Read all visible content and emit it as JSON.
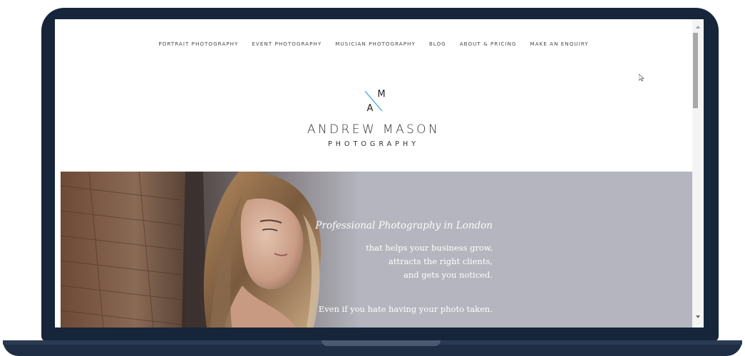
{
  "nav": {
    "items": [
      {
        "label": "PORTRAIT PHOTOGRAPHY"
      },
      {
        "label": "EVENT PHOTOGRAPHY"
      },
      {
        "label": "MUSICIAN PHOTOGRAPHY"
      },
      {
        "label": "BLOG"
      },
      {
        "label": "ABOUT & PRICING"
      },
      {
        "label": "MAKE AN ENQUIRY"
      }
    ]
  },
  "logo": {
    "monogram_top": "M",
    "monogram_bottom": "A",
    "name": "ANDREW MASON",
    "subtitle": "PHOTOGRAPHY",
    "accent_color": "#5fb8d6"
  },
  "hero": {
    "title": "Professional Photography in London",
    "lines": [
      "that helps your business grow,",
      "attracts the right clients,",
      "and gets you noticed."
    ],
    "tagline": "Even if you hate having your photo taken.",
    "background_color": "#b4b5be"
  },
  "colors": {
    "laptop_frame": "#16253a",
    "page_background": "#ffffff",
    "nav_text": "#4a4a4a"
  }
}
